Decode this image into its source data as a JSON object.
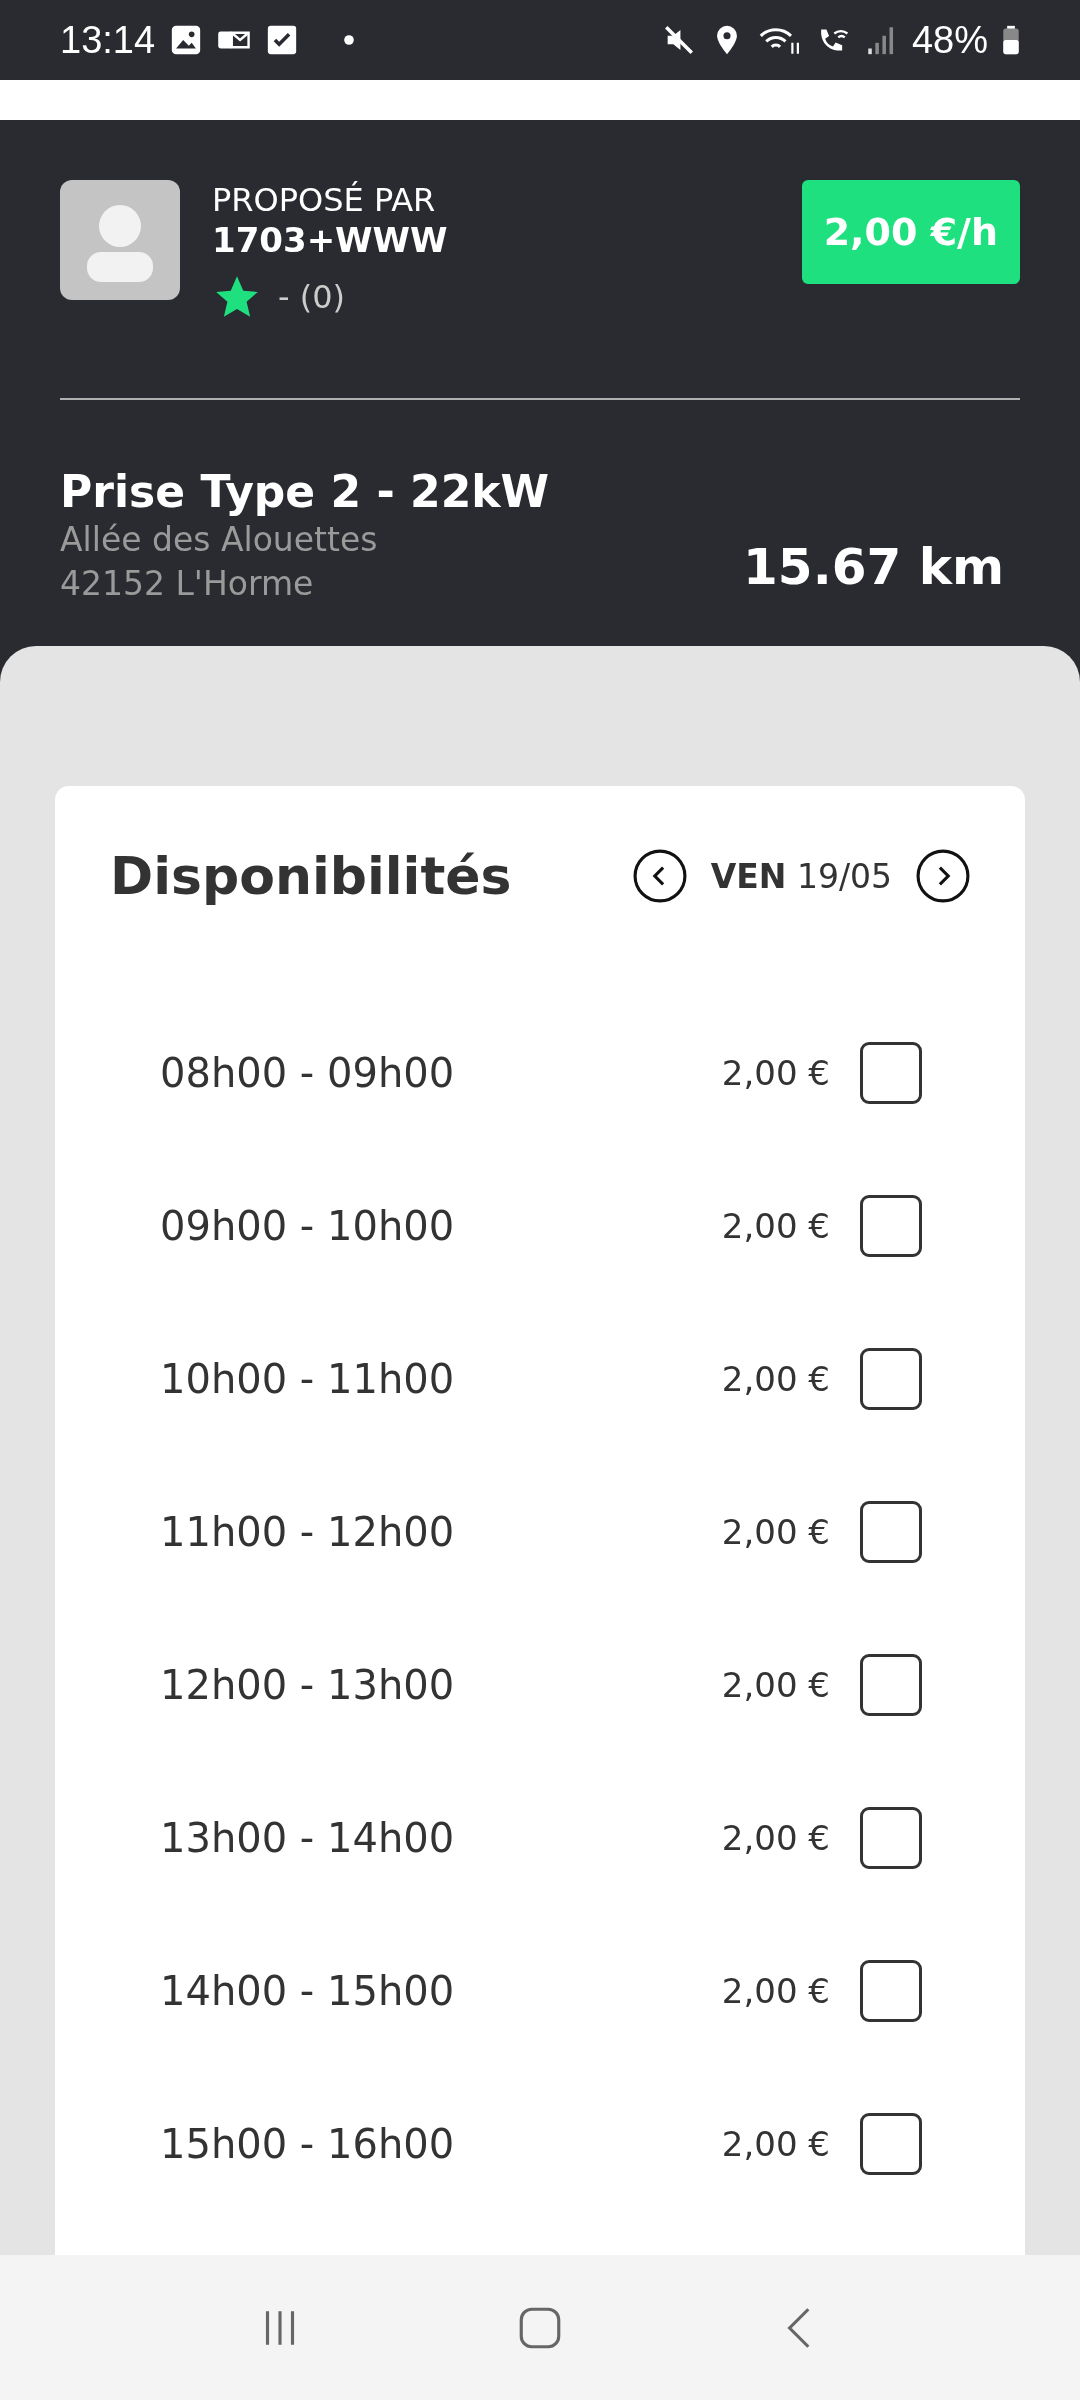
{
  "status_bar": {
    "time": "13:14",
    "battery": "48%"
  },
  "host": {
    "caption": "PROPOSÉ PAR",
    "name": "1703+WWW",
    "rating": "- (0)",
    "price": "2,00 €/h"
  },
  "station": {
    "title": "Prise Type 2 - 22kW",
    "address_line1": "Allée des Alouettes",
    "address_line2": "42152 L'Horme",
    "distance": "15.67 km"
  },
  "availability": {
    "title": "Disponibilités",
    "date": "**VEN** 19/05",
    "slots": [
      {
        "time": "08h00 - 09h00",
        "price": "2,00 €",
        "checked": false
      },
      {
        "time": "09h00 - 10h00",
        "price": "2,00 €",
        "checked": false
      },
      {
        "time": "10h00 - 11h00",
        "price": "2,00 €",
        "checked": false
      },
      {
        "time": "11h00 - 12h00",
        "price": "2,00 €",
        "checked": false
      },
      {
        "time": "12h00 - 13h00",
        "price": "2,00 €",
        "checked": false
      },
      {
        "time": "13h00 - 14h00",
        "price": "2,00 €",
        "checked": false
      },
      {
        "time": "14h00 - 15h00",
        "price": "2,00 €",
        "checked": false
      },
      {
        "time": "15h00 - 16h00",
        "price": "2,00 €",
        "checked": false
      }
    ]
  }
}
